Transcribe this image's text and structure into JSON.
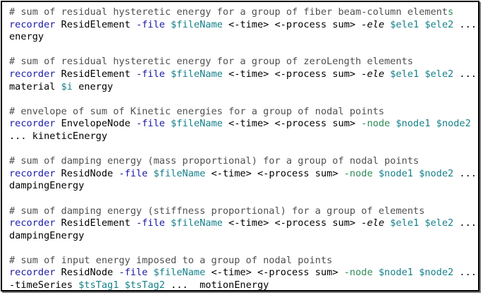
{
  "colors": {
    "comment": "#505050",
    "keyword": "#1a1aa6",
    "variable": "#16818a",
    "option": "#2e8b57",
    "text": "#000000"
  },
  "lines": [
    [
      {
        "t": "# sum of residual hysteretic energy for a group of fiber beam-column element",
        "c": "comment"
      },
      {
        "t": "s",
        "c": "opt"
      }
    ],
    [
      {
        "t": "recorder",
        "c": "kw"
      },
      {
        "t": " ResidElement ",
        "c": "plain"
      },
      {
        "t": "-file",
        "c": "kw"
      },
      {
        "t": " ",
        "c": "plain"
      },
      {
        "t": "$fileName",
        "c": "var"
      },
      {
        "t": " <-time> <-process sum> ",
        "c": "plain"
      },
      {
        "t": "-ele",
        "c": "it"
      },
      {
        "t": " ",
        "c": "plain"
      },
      {
        "t": "$ele1",
        "c": "var"
      },
      {
        "t": " ",
        "c": "plain"
      },
      {
        "t": "$ele2",
        "c": "var"
      },
      {
        "t": " ...",
        "c": "plain"
      }
    ],
    [
      {
        "t": "energy",
        "c": "plain"
      }
    ],
    [],
    [
      {
        "t": "# sum of residual hysteretic energy for a group of zeroLength elements",
        "c": "comment"
      }
    ],
    [
      {
        "t": "recorder",
        "c": "kw"
      },
      {
        "t": " ResidElement ",
        "c": "plain"
      },
      {
        "t": "-file",
        "c": "kw"
      },
      {
        "t": " ",
        "c": "plain"
      },
      {
        "t": "$fileName",
        "c": "var"
      },
      {
        "t": " <-time> <-process sum> ",
        "c": "plain"
      },
      {
        "t": "-ele",
        "c": "it"
      },
      {
        "t": " ",
        "c": "plain"
      },
      {
        "t": "$ele1",
        "c": "var"
      },
      {
        "t": " ",
        "c": "plain"
      },
      {
        "t": "$ele2",
        "c": "var"
      },
      {
        "t": " ...",
        "c": "plain"
      }
    ],
    [
      {
        "t": "material ",
        "c": "plain"
      },
      {
        "t": "$i",
        "c": "var"
      },
      {
        "t": " energy",
        "c": "plain"
      }
    ],
    [],
    [
      {
        "t": "# envelope of sum of Kinetic energies for a group of nodal points",
        "c": "comment"
      }
    ],
    [
      {
        "t": "recorder",
        "c": "kw"
      },
      {
        "t": " EnvelopeNode ",
        "c": "plain"
      },
      {
        "t": "-file",
        "c": "kw"
      },
      {
        "t": " ",
        "c": "plain"
      },
      {
        "t": "$fileName",
        "c": "var"
      },
      {
        "t": " <-time> <-process sum> ",
        "c": "plain"
      },
      {
        "t": "-node",
        "c": "opt"
      },
      {
        "t": " ",
        "c": "plain"
      },
      {
        "t": "$node1",
        "c": "var"
      },
      {
        "t": " ",
        "c": "plain"
      },
      {
        "t": "$node2",
        "c": "var"
      }
    ],
    [
      {
        "t": "... kineticEnergy",
        "c": "plain"
      }
    ],
    [],
    [
      {
        "t": "# sum of damping energy (mass proportional) for a group of nodal points",
        "c": "comment"
      }
    ],
    [
      {
        "t": "recorder",
        "c": "kw"
      },
      {
        "t": " ResidNode ",
        "c": "plain"
      },
      {
        "t": "-file",
        "c": "kw"
      },
      {
        "t": " ",
        "c": "plain"
      },
      {
        "t": "$fileName",
        "c": "var"
      },
      {
        "t": " <-time> <-process sum> ",
        "c": "plain"
      },
      {
        "t": "-node",
        "c": "opt"
      },
      {
        "t": " ",
        "c": "plain"
      },
      {
        "t": "$node1",
        "c": "var"
      },
      {
        "t": " ",
        "c": "plain"
      },
      {
        "t": "$node2",
        "c": "var"
      },
      {
        "t": " ...",
        "c": "plain"
      }
    ],
    [
      {
        "t": "dampingEnergy",
        "c": "plain"
      }
    ],
    [],
    [
      {
        "t": "# sum of damping energy (stiffness proportional) for a group of elements",
        "c": "comment"
      }
    ],
    [
      {
        "t": "recorder",
        "c": "kw"
      },
      {
        "t": " ResidElement ",
        "c": "plain"
      },
      {
        "t": "-file",
        "c": "kw"
      },
      {
        "t": " ",
        "c": "plain"
      },
      {
        "t": "$fileName",
        "c": "var"
      },
      {
        "t": " <-time> <-process sum> ",
        "c": "plain"
      },
      {
        "t": "-ele",
        "c": "it"
      },
      {
        "t": " ",
        "c": "plain"
      },
      {
        "t": "$ele1",
        "c": "var"
      },
      {
        "t": " ",
        "c": "plain"
      },
      {
        "t": "$ele2",
        "c": "var"
      },
      {
        "t": " ...",
        "c": "plain"
      }
    ],
    [
      {
        "t": "dampingEnergy",
        "c": "plain"
      }
    ],
    [],
    [
      {
        "t": "# sum of input energy imposed to a group of nodal points",
        "c": "comment"
      }
    ],
    [
      {
        "t": "recorder",
        "c": "kw"
      },
      {
        "t": " ResidNode ",
        "c": "plain"
      },
      {
        "t": "-file",
        "c": "kw"
      },
      {
        "t": " ",
        "c": "plain"
      },
      {
        "t": "$fileName",
        "c": "var"
      },
      {
        "t": " <-time> <-process sum> ",
        "c": "plain"
      },
      {
        "t": "-node",
        "c": "opt"
      },
      {
        "t": " ",
        "c": "plain"
      },
      {
        "t": "$node1",
        "c": "var"
      },
      {
        "t": " ",
        "c": "plain"
      },
      {
        "t": "$node2",
        "c": "var"
      },
      {
        "t": " ...",
        "c": "plain"
      }
    ],
    [
      {
        "t": "-timeSeries ",
        "c": "plain"
      },
      {
        "t": "$tsTag1",
        "c": "var"
      },
      {
        "t": " ",
        "c": "plain"
      },
      {
        "t": "$tsTag2",
        "c": "var"
      },
      {
        "t": " ...  motionEnergy",
        "c": "plain"
      }
    ]
  ]
}
